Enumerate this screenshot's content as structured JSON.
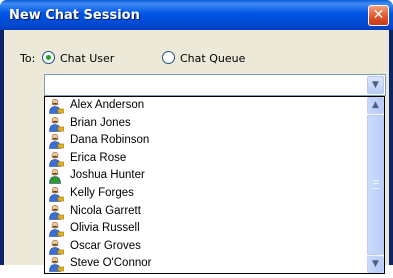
{
  "window": {
    "title": "New Chat Session",
    "close_glyph": "✕"
  },
  "form": {
    "to_label": "To:",
    "options": [
      {
        "label": "Chat User",
        "selected": true
      },
      {
        "label": "Chat Queue",
        "selected": false
      }
    ],
    "combo_value": ""
  },
  "dropdown": {
    "items": [
      {
        "name": "Alex Anderson",
        "icon": "user-icon"
      },
      {
        "name": "Brian Jones",
        "icon": "user-icon"
      },
      {
        "name": "Dana Robinson",
        "icon": "user-icon"
      },
      {
        "name": "Erica Rose",
        "icon": "user-icon"
      },
      {
        "name": "Joshua Hunter",
        "icon": "user-online-icon"
      },
      {
        "name": "Kelly Forges",
        "icon": "user-icon"
      },
      {
        "name": "Nicola Garrett",
        "icon": "user-icon"
      },
      {
        "name": "Olivia Russell",
        "icon": "user-icon"
      },
      {
        "name": "Oscar Groves",
        "icon": "user-icon"
      },
      {
        "name": "Steve O'Connor",
        "icon": "user-icon"
      }
    ]
  },
  "colors": {
    "titlebar": "#0055e5",
    "dialog_face": "#ece9d8",
    "radio_dot": "#21a121"
  }
}
